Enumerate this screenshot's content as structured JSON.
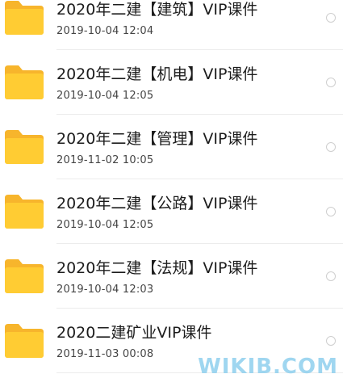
{
  "files": [
    {
      "name": "2020年二建【建筑】VIP课件",
      "date": "2019-10-04  12:04"
    },
    {
      "name": "2020年二建【机电】VIP课件",
      "date": "2019-10-04  12:05"
    },
    {
      "name": "2020年二建【管理】VIP课件",
      "date": "2019-11-02  10:05"
    },
    {
      "name": "2020年二建【公路】VIP课件",
      "date": "2019-10-04  12:05"
    },
    {
      "name": "2020年二建【法规】VIP课件",
      "date": "2019-10-04  12:03"
    },
    {
      "name": "2020二建矿业VIP课件",
      "date": "2019-11-03  00:08"
    }
  ],
  "icons": {
    "folder": "folder-icon",
    "select": "radio-unselected-icon"
  },
  "colors": {
    "folder": "#FFCC33",
    "folder_tab": "#F7B52C"
  },
  "watermark": "WIKIB.COM"
}
